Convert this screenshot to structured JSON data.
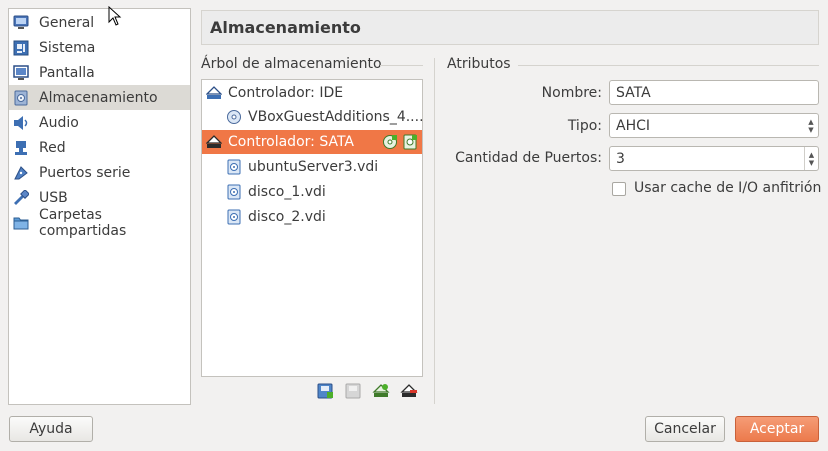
{
  "sidebar": {
    "items": [
      {
        "label": "General",
        "icon": "monitor-icon"
      },
      {
        "label": "Sistema",
        "icon": "motherboard-icon"
      },
      {
        "label": "Pantalla",
        "icon": "display-icon"
      },
      {
        "label": "Almacenamiento",
        "icon": "storage-icon"
      },
      {
        "label": "Audio",
        "icon": "speaker-icon"
      },
      {
        "label": "Red",
        "icon": "network-icon"
      },
      {
        "label": "Puertos serie",
        "icon": "serial-port-icon"
      },
      {
        "label": "USB",
        "icon": "usb-icon"
      },
      {
        "label": "Carpetas compartidas",
        "icon": "folder-icon"
      }
    ],
    "selected": "Almacenamiento"
  },
  "header": {
    "title": "Almacenamiento"
  },
  "storage_tree": {
    "title": "Árbol de almacenamiento",
    "controllers": [
      {
        "label": "Controlador: IDE",
        "devices": [
          "VBoxGuestAdditions_4...."
        ]
      },
      {
        "label": "Controlador: SATA",
        "devices": [
          "ubuntuServer3.vdi",
          "disco_1.vdi",
          "disco_2.vdi"
        ]
      }
    ]
  },
  "attributes": {
    "title": "Atributos",
    "name_label": "Nombre:",
    "name_value": "SATA",
    "type_label": "Tipo:",
    "type_value": "AHCI",
    "ports_label": "Cantidad de Puertos:",
    "ports_value": "3",
    "cache_label": "Usar cache de I/O anfitrión",
    "cache_checked": false
  },
  "footer": {
    "help": "Ayuda",
    "cancel": "Cancelar",
    "accept": "Aceptar"
  },
  "colors": {
    "selection": "#f07746",
    "accept_button": "#ec7a4c"
  }
}
